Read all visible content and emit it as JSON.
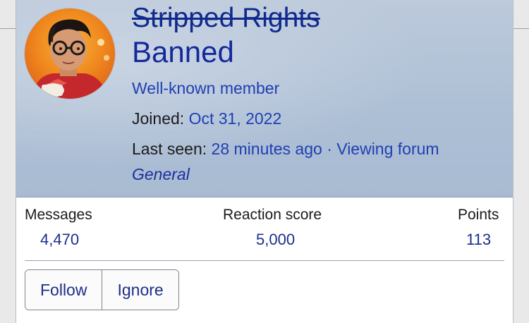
{
  "profile": {
    "username": "Stripped Rights",
    "banner": "Banned",
    "rank": "Well-known member",
    "joined_label": "Joined:",
    "joined_value": "Oct 31, 2022",
    "last_seen_label": "Last seen:",
    "last_seen_value": "28 minutes ago",
    "separator": "·",
    "activity": "Viewing forum",
    "forum_name": "General"
  },
  "stats": [
    {
      "label": "Messages",
      "value": "4,470"
    },
    {
      "label": "Reaction score",
      "value": "5,000"
    },
    {
      "label": "Points",
      "value": "113"
    }
  ],
  "actions": {
    "follow_label": "Follow",
    "ignore_label": "Ignore"
  },
  "colors": {
    "header_bg": "#b3c3d7",
    "link": "#1f3fb3",
    "banned": "#14299a"
  }
}
